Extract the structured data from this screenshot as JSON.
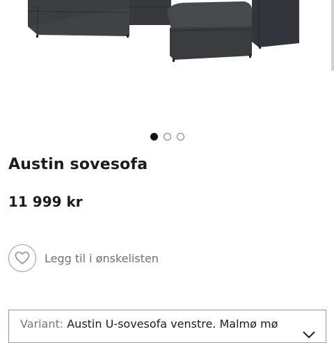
{
  "product": {
    "title": "Austin sovesofa",
    "price": "11 999 kr",
    "image_icon": "sofa-image"
  },
  "carousel": {
    "count": 3,
    "active_index": 0
  },
  "wishlist": {
    "label": "Legg til i ønskelisten",
    "icon": "heart-icon"
  },
  "variant": {
    "label": "Variant:",
    "value": "Austin U-sovesofa venstre. Malmø mø",
    "icon": "chevron-down-icon"
  },
  "colors": {
    "text": "#1c1c1c",
    "muted": "#6f6f6f",
    "border": "#9a9a9a",
    "sofa": "#3c3d40"
  }
}
